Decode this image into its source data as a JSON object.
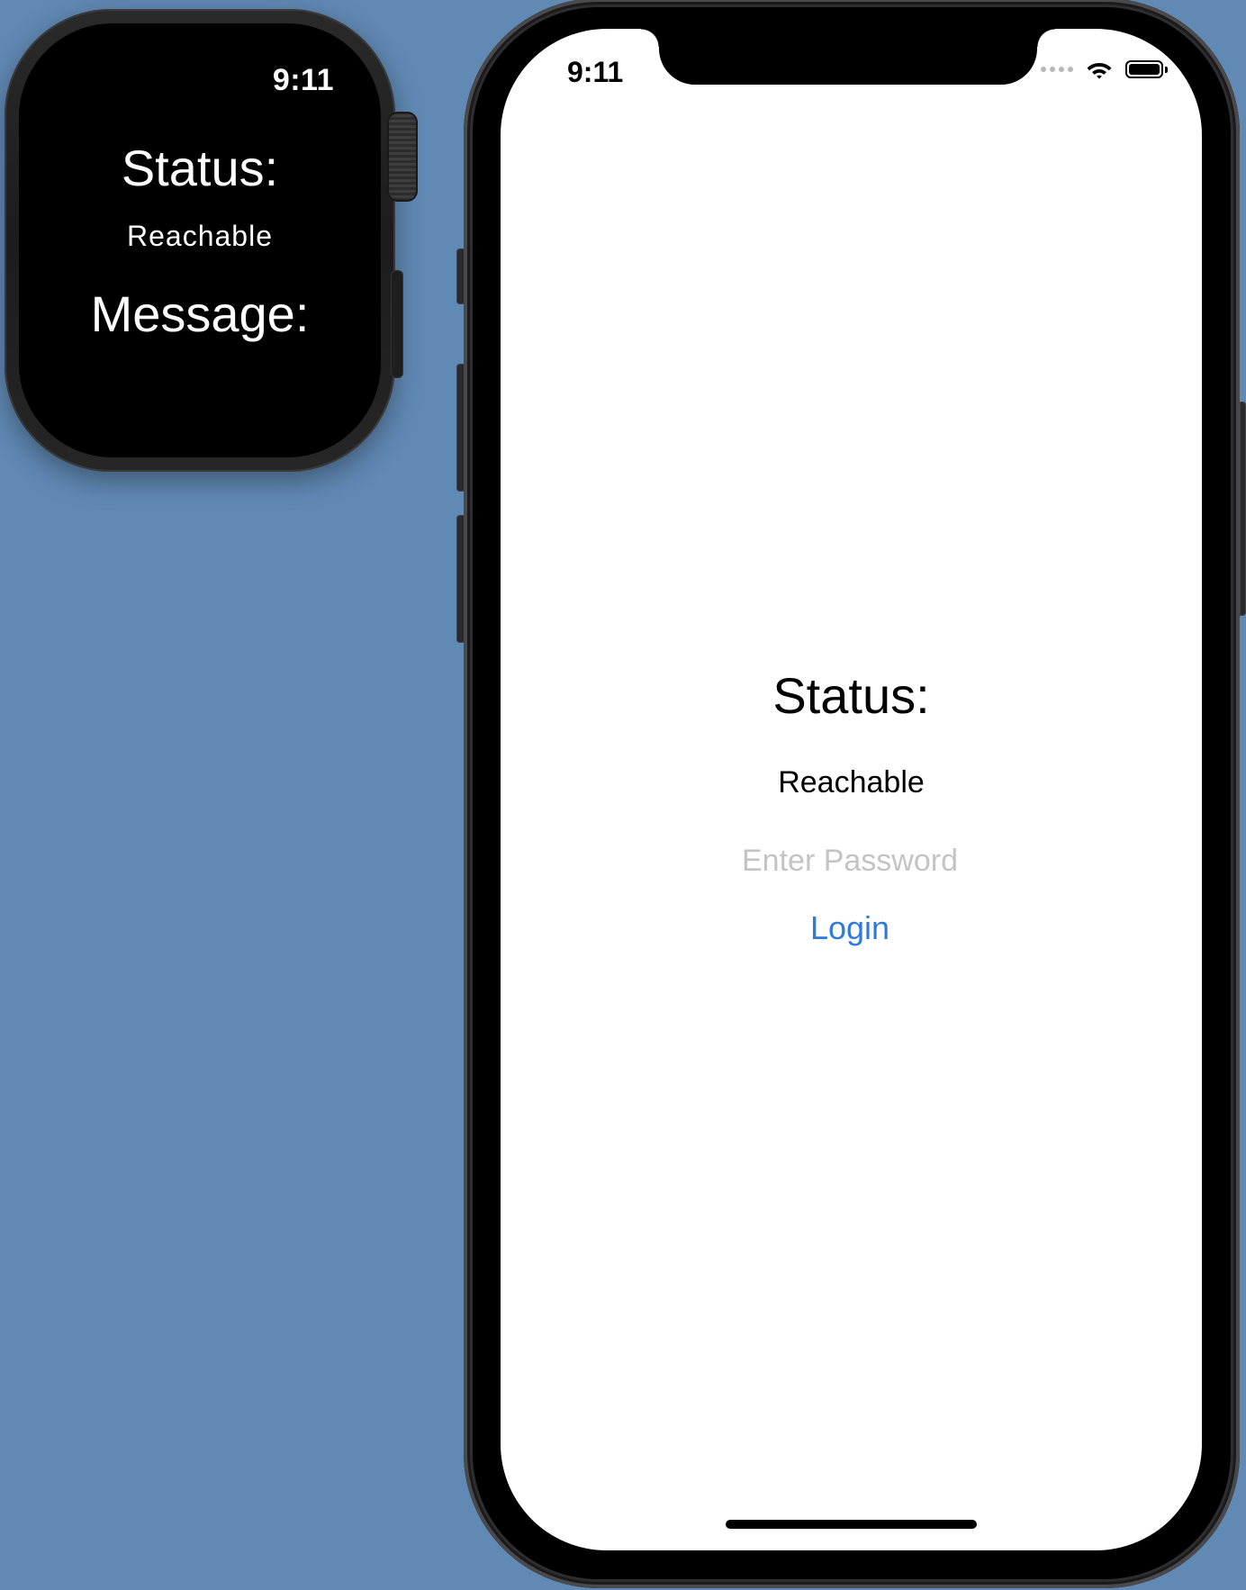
{
  "watch": {
    "time": "9:11",
    "status_label": "Status:",
    "status_value": "Reachable",
    "message_label": "Message:"
  },
  "phone": {
    "time": "9:11",
    "status_label": "Status:",
    "status_value": "Reachable",
    "password_placeholder": "Enter Password",
    "password_value": "",
    "login_label": "Login",
    "status_icons": [
      "cellular-signal-icon",
      "wifi-icon",
      "battery-icon"
    ]
  },
  "colors": {
    "desktop_background": "#6089b4",
    "accent": "#2f7bdc",
    "placeholder": "#c4c4c6"
  }
}
